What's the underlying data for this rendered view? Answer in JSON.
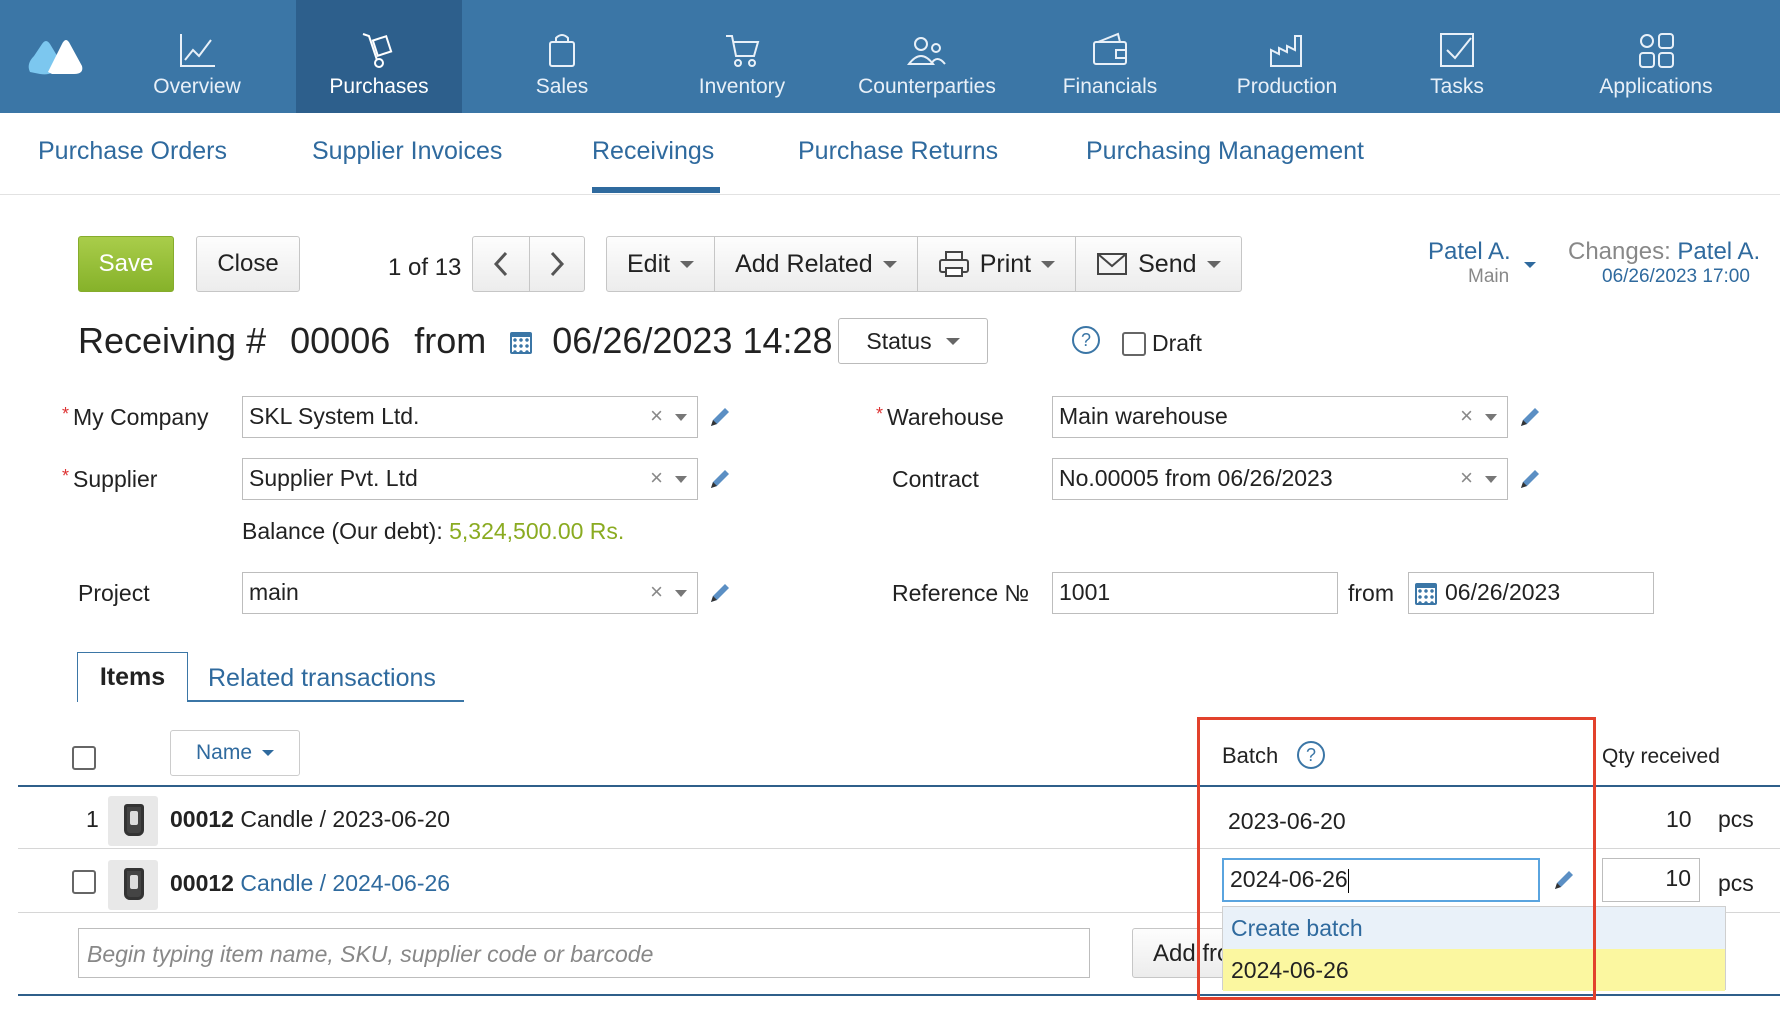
{
  "topnav": {
    "items": [
      {
        "label": "Overview",
        "icon": "chart-line-icon"
      },
      {
        "label": "Purchases",
        "icon": "hand-truck-icon",
        "active": true
      },
      {
        "label": "Sales",
        "icon": "shopping-bag-icon"
      },
      {
        "label": "Inventory",
        "icon": "cart-icon"
      },
      {
        "label": "Counterparties",
        "icon": "people-icon"
      },
      {
        "label": "Financials",
        "icon": "wallet-icon"
      },
      {
        "label": "Production",
        "icon": "factory-icon"
      },
      {
        "label": "Tasks",
        "icon": "checkbox-icon"
      },
      {
        "label": "Applications",
        "icon": "apps-grid-icon"
      }
    ],
    "bg_color": "#3b76a6",
    "active_color": "#2d5f8c"
  },
  "subnav": {
    "items": [
      {
        "label": "Purchase Orders"
      },
      {
        "label": "Supplier Invoices"
      },
      {
        "label": "Receivings",
        "active": true
      },
      {
        "label": "Purchase Returns"
      },
      {
        "label": "Purchasing Management"
      }
    ]
  },
  "toolbar": {
    "save_label": "Save",
    "close_label": "Close",
    "counter": "1 of 13",
    "edit_label": "Edit",
    "add_related_label": "Add Related",
    "print_label": "Print",
    "send_label": "Send"
  },
  "user": {
    "name": "Patel A.",
    "sub": "Main",
    "changes_label": "Changes:",
    "changes_user": "Patel A.",
    "changes_date": "06/26/2023 17:00"
  },
  "document": {
    "title_prefix": "Receiving #",
    "number": "00006",
    "from_label": "from",
    "datetime": "06/26/2023 14:28",
    "status_label": "Status",
    "help": "?",
    "draft_label": "Draft"
  },
  "form": {
    "my_company_label": "My Company",
    "my_company_value": "SKL System Ltd.",
    "supplier_label": "Supplier",
    "supplier_value": "Supplier Pvt. Ltd",
    "balance_label": "Balance (Our debt):",
    "balance_value": "5,324,500.00 Rs.",
    "project_label": "Project",
    "project_value": "main",
    "warehouse_label": "Warehouse",
    "warehouse_value": "Main warehouse",
    "contract_label": "Contract",
    "contract_value": "No.00005 from 06/26/2023",
    "reference_label": "Reference №",
    "reference_value": "1001",
    "ref_from_label": "from",
    "ref_date": "06/26/2023",
    "clear_symbol": "×"
  },
  "tabs": {
    "items_label": "Items",
    "related_label": "Related transactions"
  },
  "table": {
    "name_col": "Name",
    "batch_col": "Batch",
    "qty_col": "Qty received",
    "rows": [
      {
        "num": "1",
        "code": "00012",
        "name": "Candle / 2023-06-20",
        "batch": "2023-06-20",
        "qty": "10",
        "unit": "pcs"
      },
      {
        "num": "",
        "code": "00012",
        "name": "Candle / 2024-06-26",
        "batch": "2024-06-26",
        "qty": "10",
        "unit": "pcs"
      }
    ],
    "dropdown": {
      "create_label": "Create batch",
      "option": "2024-06-26"
    },
    "search_placeholder": "Begin typing item name, SKU, supplier code or barcode",
    "add_from_label": "Add from"
  },
  "colors": {
    "link": "#2f6a9e",
    "save_green": "#8cb52e",
    "balance_green": "#8aab21",
    "highlight": "#e2412c"
  }
}
